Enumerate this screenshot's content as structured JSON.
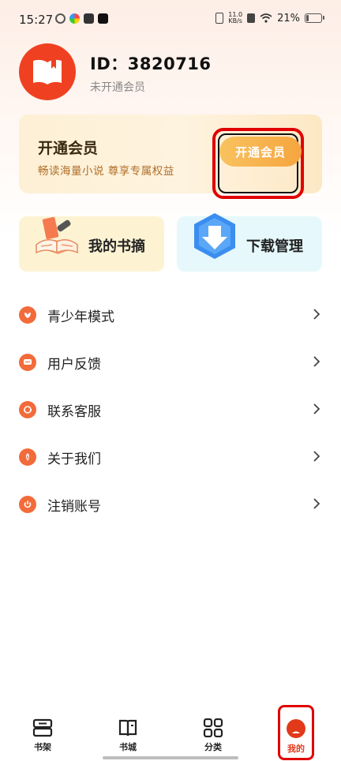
{
  "status_bar": {
    "time": "15:27",
    "net_speed_value": "11.0",
    "net_speed_unit": "KB/s",
    "battery": "21%",
    "battery_level": 0.21
  },
  "profile": {
    "id_text": "ID：3820716",
    "member_status": "未开通会员"
  },
  "vip_card": {
    "title": "开通会员",
    "subtitle": "畅读海量小说 尊享专属权益",
    "button_label": "开通会员"
  },
  "quick_actions": [
    {
      "label": "我的书摘",
      "icon": "book-notes-icon"
    },
    {
      "label": "下载管理",
      "icon": "download-icon"
    }
  ],
  "menu": [
    {
      "label": "青少年模式",
      "icon": "youth-mode-icon"
    },
    {
      "label": "用户反馈",
      "icon": "feedback-icon"
    },
    {
      "label": "联系客服",
      "icon": "customer-service-icon"
    },
    {
      "label": "关于我们",
      "icon": "about-icon"
    },
    {
      "label": "注销账号",
      "icon": "power-icon"
    }
  ],
  "bottom_nav": [
    {
      "label": "书架",
      "icon": "bookshelf-icon"
    },
    {
      "label": "书城",
      "icon": "bookstore-icon"
    },
    {
      "label": "分类",
      "icon": "category-icon"
    },
    {
      "label": "我的",
      "icon": "profile-icon",
      "active": true
    }
  ],
  "colors": {
    "accent": "#ef4122",
    "vip_button": "#f6a53f",
    "menu_icon": "#f26b3a",
    "active_nav": "#e2391b"
  }
}
